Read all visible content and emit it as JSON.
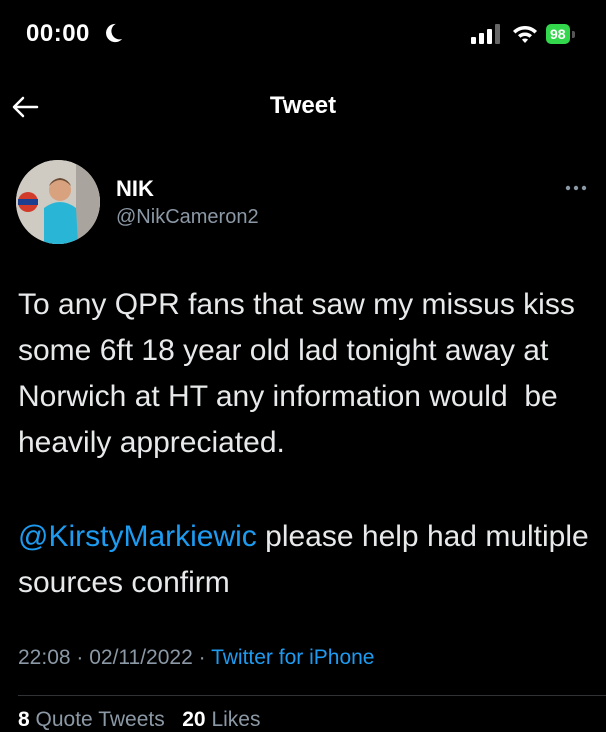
{
  "status_bar": {
    "time": "00:00",
    "battery": "98"
  },
  "nav": {
    "title": "Tweet"
  },
  "tweet": {
    "display_name": "NIK",
    "handle": "@NikCameron2",
    "text": "To any QPR fans that saw my missus kiss some 6ft 18 year old lad tonight away at Norwich at HT any information would  be heavily appreciated.",
    "mention": "@KirstyMarkiewic",
    "text_after_mention": " please help had multiple sources confirm",
    "time": "22:08",
    "date": "02/11/2022",
    "separator": " · ",
    "source": "Twitter for iPhone"
  },
  "stats": {
    "quote_tweets_count": "8",
    "quote_tweets_label": "Quote Tweets",
    "likes_count": "20",
    "likes_label": "Likes"
  },
  "colors": {
    "background": "#000000",
    "link": "#1d9bf0",
    "secondary_text": "#8b98a5",
    "battery": "#32d74b"
  },
  "icons": [
    "moon-icon",
    "signal-icon",
    "wifi-icon",
    "battery-icon",
    "back-arrow-icon",
    "more-icon"
  ]
}
